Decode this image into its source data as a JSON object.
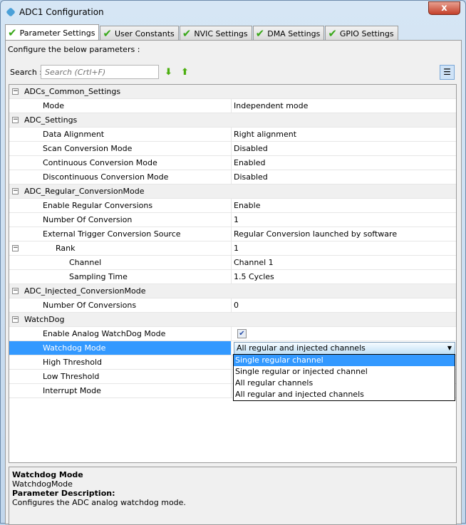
{
  "window": {
    "title": "ADC1 Configuration",
    "close": "x"
  },
  "tabs": [
    {
      "label": "Parameter Settings",
      "active": true
    },
    {
      "label": "User Constants"
    },
    {
      "label": "NVIC Settings"
    },
    {
      "label": "DMA Settings"
    },
    {
      "label": "GPIO Settings"
    }
  ],
  "configure_label": "Configure the below parameters :",
  "search": {
    "label": "Search :",
    "placeholder": "Search (Crtl+F)"
  },
  "rows": [
    {
      "name": "ADCs_Common_Settings",
      "type": "group",
      "level": 0
    },
    {
      "name": "Mode",
      "value": "Independent mode",
      "level": 1
    },
    {
      "name": "ADC_Settings",
      "type": "group",
      "level": 0
    },
    {
      "name": "Data Alignment",
      "value": "Right alignment",
      "level": 1
    },
    {
      "name": "Scan Conversion Mode",
      "value": "Disabled",
      "level": 1
    },
    {
      "name": "Continuous Conversion Mode",
      "value": "Enabled",
      "level": 1
    },
    {
      "name": "Discontinuous Conversion Mode",
      "value": "Disabled",
      "level": 1
    },
    {
      "name": "ADC_Regular_ConversionMode",
      "type": "group",
      "level": 0
    },
    {
      "name": "Enable Regular Conversions",
      "value": "Enable",
      "level": 1
    },
    {
      "name": "Number Of Conversion",
      "value": "1",
      "level": 1
    },
    {
      "name": "External Trigger Conversion Source",
      "value": "Regular Conversion launched by software",
      "level": 1
    },
    {
      "name": "Rank",
      "value": "1",
      "level": 2,
      "toggle": true
    },
    {
      "name": "Channel",
      "value": "Channel 1",
      "level": 3
    },
    {
      "name": "Sampling Time",
      "value": "1.5 Cycles",
      "level": 3
    },
    {
      "name": "ADC_Injected_ConversionMode",
      "type": "group",
      "level": 0
    },
    {
      "name": "Number Of Conversions",
      "value": "0",
      "level": 1
    },
    {
      "name": "WatchDog",
      "type": "group",
      "level": 0
    },
    {
      "name": "Enable Analog WatchDog Mode",
      "checkbox": true,
      "checked": true,
      "level": 1
    },
    {
      "name": "Watchdog Mode",
      "value": "All regular and injected channels",
      "level": 1,
      "selected": true,
      "combo": true
    },
    {
      "name": "High Threshold",
      "value": "",
      "level": 1
    },
    {
      "name": "Low Threshold",
      "value": "",
      "level": 1
    },
    {
      "name": "Interrupt Mode",
      "value": "",
      "level": 1
    }
  ],
  "dropdown": {
    "options": [
      "Single regular channel",
      "Single regular or injected channel",
      "All regular channels",
      "All regular and injected channels"
    ],
    "highlighted": 0
  },
  "description": {
    "title": "Watchdog Mode",
    "id": "WatchdogMode",
    "heading": "Parameter Description:",
    "text": "Configures the ADC analog watchdog mode."
  }
}
